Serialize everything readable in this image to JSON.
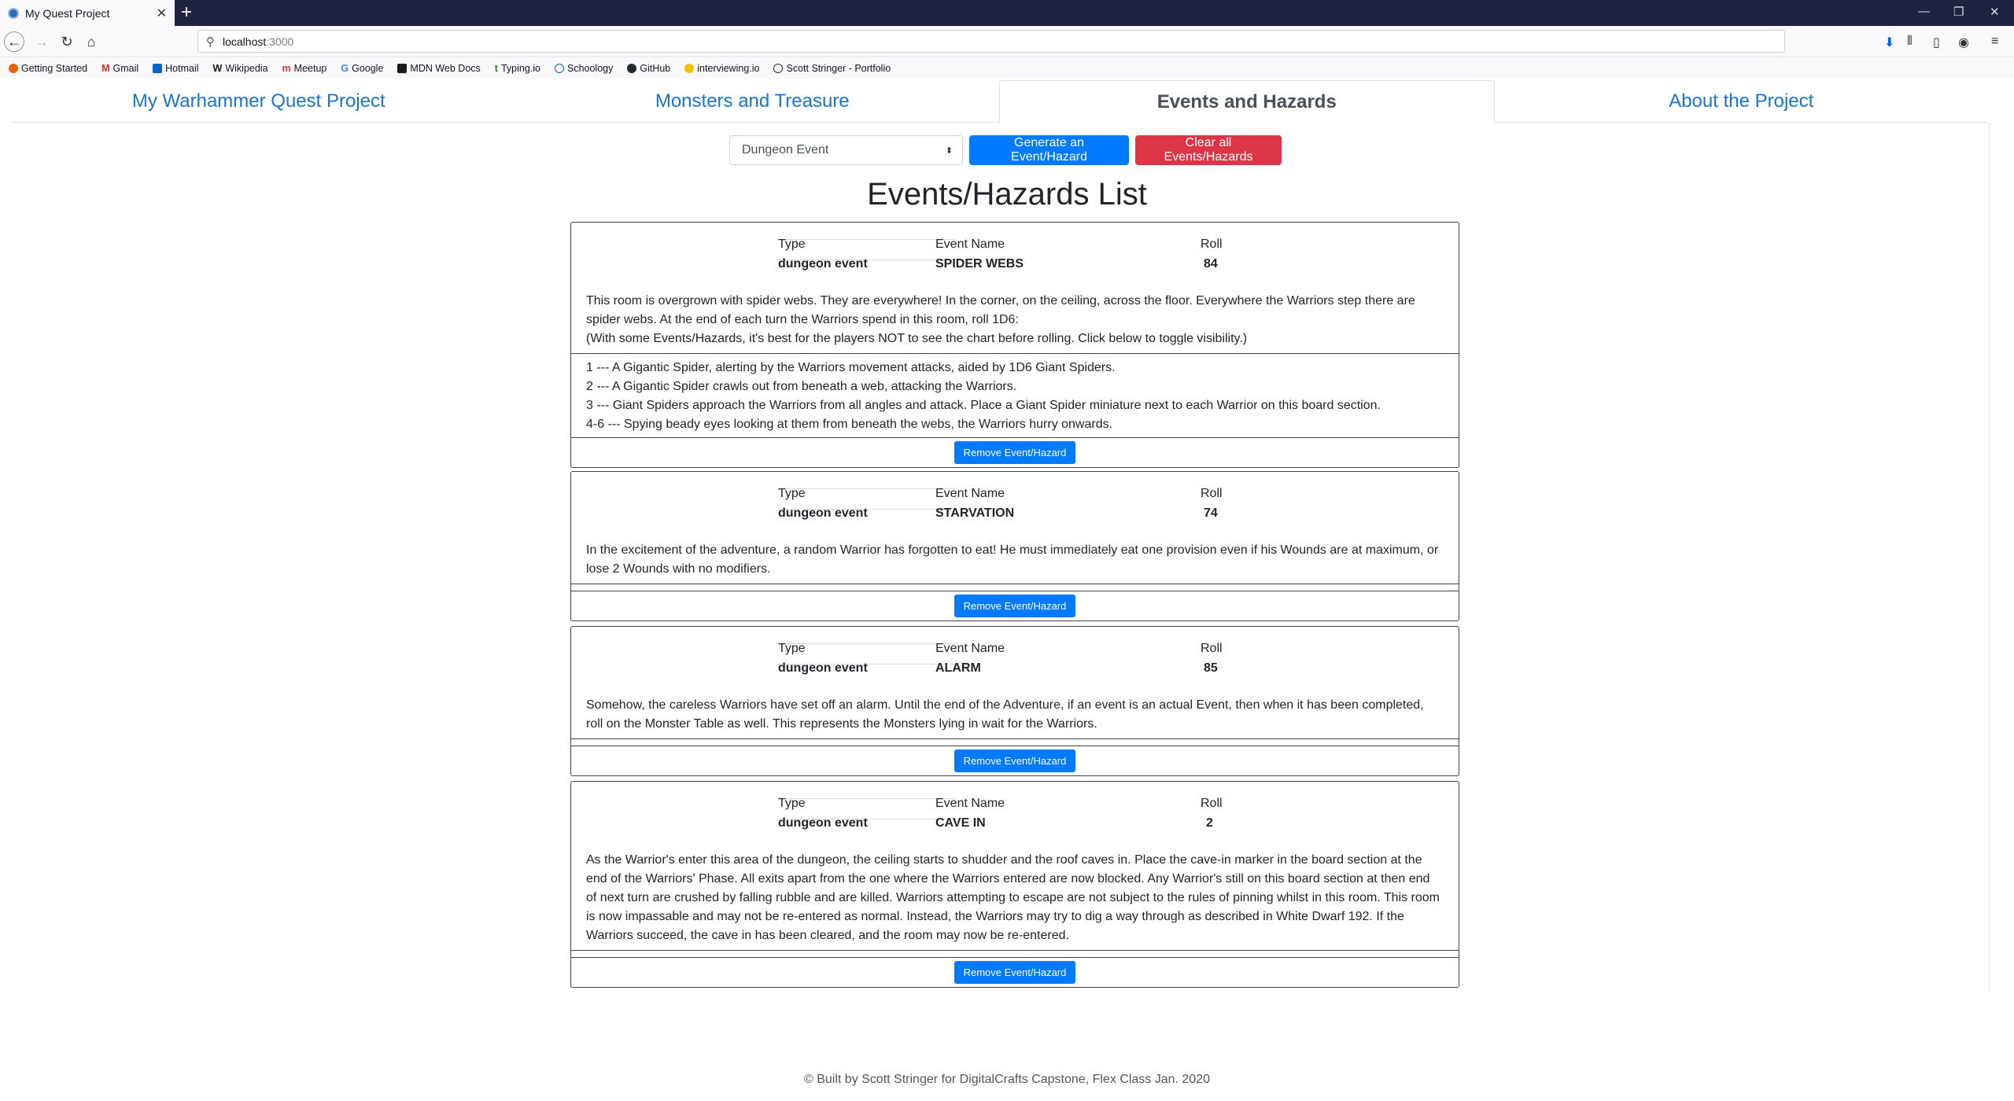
{
  "browser": {
    "tab_title": "My Quest Project",
    "url_host": "localhost",
    "url_port": ":3000",
    "bookmarks": [
      "Getting Started",
      "Gmail",
      "Hotmail",
      "Wikipedia",
      "Meetup",
      "Google",
      "MDN Web Docs",
      "Typing.io",
      "Schoology",
      "GitHub",
      "interviewing.io",
      "Scott Stringer - Portfolio"
    ]
  },
  "nav": {
    "tabs": [
      "My Warhammer Quest Project",
      "Monsters and Treasure",
      "Events and Hazards",
      "About the Project"
    ],
    "active_index": 2
  },
  "controls": {
    "select_value": "Dungeon Event",
    "generate_label": "Generate an Event/Hazard",
    "clear_label": "Clear all Events/Hazards"
  },
  "list_title": "Events/Hazards List",
  "columns": {
    "type": "Type",
    "name": "Event Name",
    "roll": "Roll"
  },
  "remove_label": "Remove Event/Hazard",
  "events": [
    {
      "type": "dungeon event",
      "name": "SPIDER WEBS",
      "roll": "84",
      "description": "This room is overgrown with spider webs. They are everywhere! In the corner, on the ceiling, across the floor. Everywhere the Warriors step there are spider webs. At the end of each turn the Warriors spend in this room, roll 1D6:",
      "note": "(With some Events/Hazards, it's best for the players NOT to see the chart before rolling. Click below to toggle visibility.)",
      "chart": [
        "1 --- A Gigantic Spider, alerting by the Warriors movement attacks, aided by 1D6 Giant Spiders.",
        "2 --- A Gigantic Spider crawls out from beneath a web, attacking the Warriors.",
        "3 --- Giant Spiders approach the Warriors from all angles and attack. Place a Giant Spider miniature next to each Warrior on this board section.",
        "4-6 --- Spying beady eyes looking at them from beneath the webs, the Warriors hurry onwards."
      ]
    },
    {
      "type": "dungeon event",
      "name": "STARVATION",
      "roll": "74",
      "description": "In the excitement of the adventure, a random Warrior has forgotten to eat! He must immediately eat one provision even if his Wounds are at maximum, or lose 2 Wounds with no modifiers.",
      "note": "",
      "chart": []
    },
    {
      "type": "dungeon event",
      "name": "ALARM",
      "roll": "85",
      "description": "Somehow, the careless Warriors have set off an alarm. Until the end of the Adventure, if an event is an actual Event, then when it has been completed, roll on the Monster Table as well. This represents the Monsters lying in wait for the Warriors.",
      "note": "",
      "chart": []
    },
    {
      "type": "dungeon event",
      "name": "CAVE IN",
      "roll": "2",
      "description": "As the Warrior's enter this area of the dungeon, the ceiling starts to shudder and the roof caves in. Place the cave-in marker in the board section at the end of the Warriors' Phase. All exits apart from the one where the Warriors entered are now blocked. Any Warrior's still on this board section at then end of next turn are crushed by falling rubble and are killed. Warriors attempting to escape are not subject to the rules of pinning whilst in this room. This room is now impassable and may not be re-entered as normal. Instead, the Warriors may try to dig a way through as described in White Dwarf 192. If the Warriors succeed, the cave in has been cleared, and the room may now be re-entered.",
      "note": "",
      "chart": []
    }
  ],
  "footer": "© Built by Scott Stringer for DigitalCrafts Capstone, Flex Class Jan. 2020"
}
